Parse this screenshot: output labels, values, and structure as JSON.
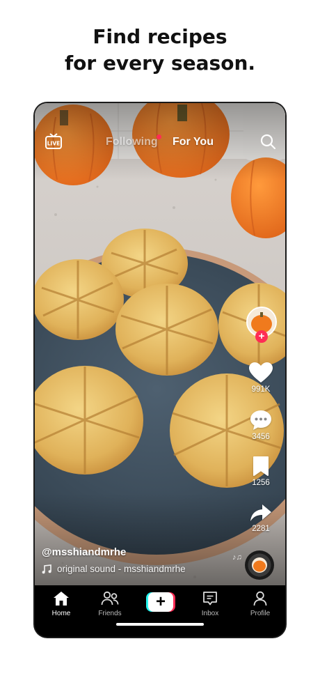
{
  "headline": {
    "line1": "Find recipes",
    "line2": "for every season."
  },
  "top_bar": {
    "live_icon": "live-icon",
    "tabs": [
      {
        "label": "Following",
        "active": false,
        "has_dot": true
      },
      {
        "label": "For You",
        "active": true
      }
    ],
    "search_icon": "search-icon"
  },
  "video": {
    "username": "@msshiandmrhe",
    "sound": "original sound - msshiandmrhe",
    "description": "pumpkin shaped bread rolls on a plate"
  },
  "actions": {
    "likes": "991K",
    "comments": "3456",
    "bookmarks": "1256",
    "shares": "2281"
  },
  "nav": [
    {
      "label": "Home",
      "icon": "home-icon",
      "active": true
    },
    {
      "label": "Friends",
      "icon": "friends-icon",
      "active": false
    },
    {
      "label": "",
      "icon": "plus-icon",
      "active": false
    },
    {
      "label": "Inbox",
      "icon": "inbox-icon",
      "active": false
    },
    {
      "label": "Profile",
      "icon": "profile-icon",
      "active": false
    }
  ],
  "colors": {
    "accent_pink": "#fe2c55",
    "accent_cyan": "#25f4ee",
    "nav_background": "#000000"
  }
}
